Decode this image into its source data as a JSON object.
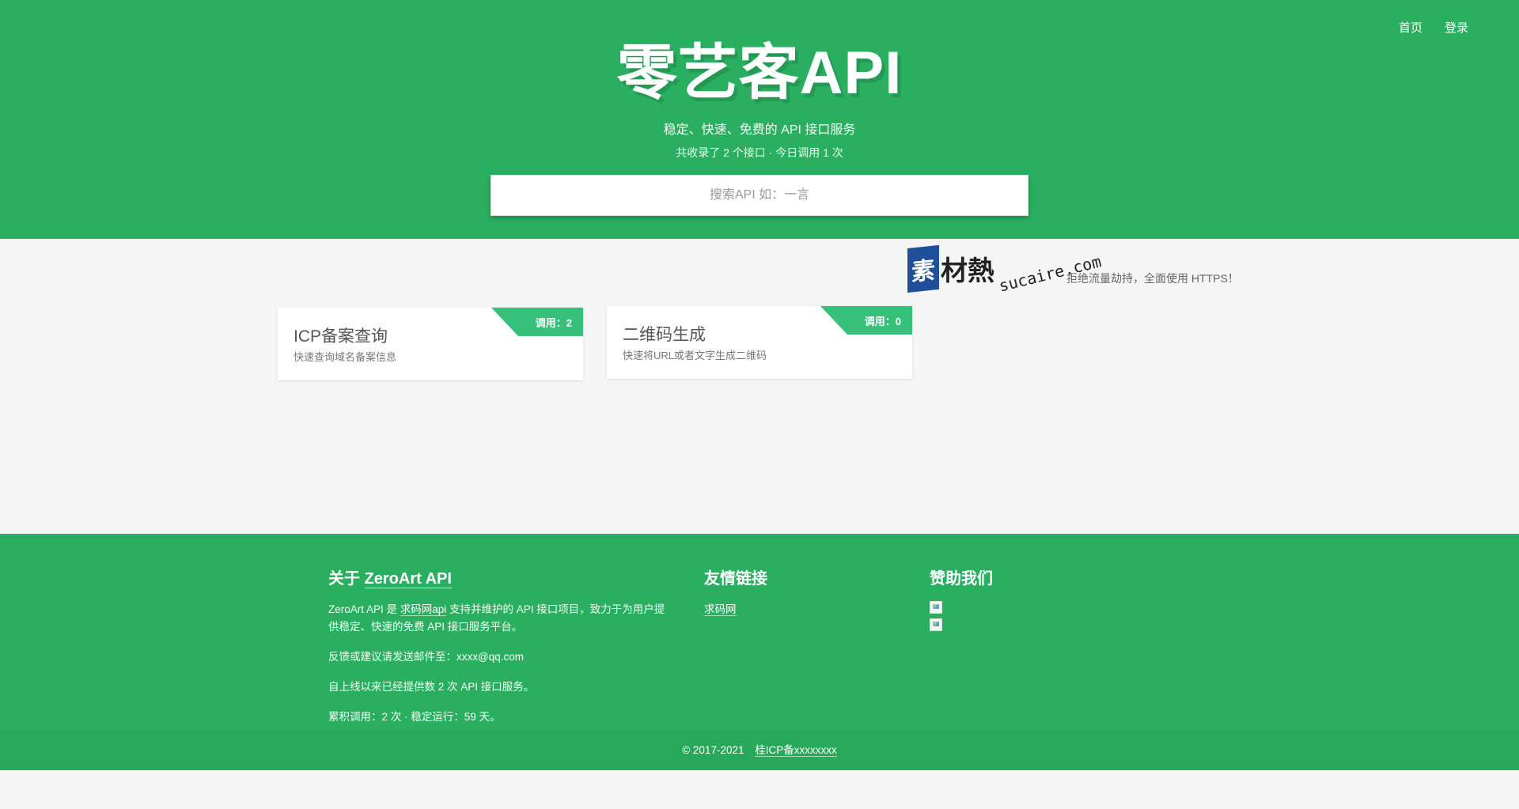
{
  "nav": {
    "home": "首页",
    "login": "登录"
  },
  "hero": {
    "title": "零艺客API",
    "subtitle": "稳定、快速、免费的 API 接口服务",
    "stats": "共收录了 2 个接口 · 今日调用 1 次"
  },
  "search": {
    "placeholder": "搜索API 如：一言",
    "value": ""
  },
  "watermark": {
    "blue_char": "素",
    "chars": "材熱",
    "url": "sucaire.com"
  },
  "notice": "拒绝流量劫持，全面使用 HTTPS！",
  "cards": [
    {
      "badge": "调用：2",
      "title": "ICP备案查询",
      "desc": "快速查询域名备案信息"
    },
    {
      "badge": "调用：0",
      "title": "二维码生成",
      "desc": "快速将URL或者文字生成二维码"
    }
  ],
  "footer": {
    "about": {
      "heading_prefix": "关于 ",
      "heading_link": "ZeroArt API",
      "intro_part1": "ZeroArt API 是 ",
      "intro_link": "求码网api",
      "intro_part2": " 支持并维护的 API 接口项目，致力于为用户提供稳定、快速的免费 API 接口服务平台。",
      "feedback": "反馈或建议请发送邮件至：xxxx@qq.com",
      "served": "自上线以来已经提供数 2 次 API 接口服务。",
      "summary": "累积调用：2 次 · 稳定运行：59 天。"
    },
    "links": {
      "heading": "友情链接",
      "items": [
        "求码网"
      ]
    },
    "sponsor": {
      "heading": "赞助我们"
    },
    "copyright": {
      "text": "© 2017-2021",
      "icp": "桂ICP备xxxxxxxx"
    }
  },
  "colors": {
    "brand_green": "#2aaf60",
    "ribbon_green": "#37c07a",
    "page_bg": "#f5f5f5"
  }
}
